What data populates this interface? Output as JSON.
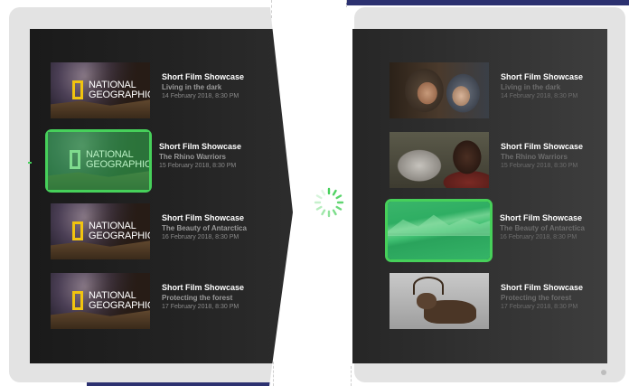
{
  "left_list": {
    "items": [
      {
        "title": "Short Film Showcase",
        "subtitle": "Living in the dark",
        "date": "14 February 2018, 8:30 PM",
        "logo_line1": "NATIONAL",
        "logo_line2": "GEOGRAPHIC"
      },
      {
        "title": "Short Film Showcase",
        "subtitle": "The Rhino Warriors",
        "date": "15 February 2018, 8:30 PM",
        "logo_line1": "NATIONAL",
        "logo_line2": "GEOGRAPHIC",
        "selected": true
      },
      {
        "title": "Short Film Showcase",
        "subtitle": "The Beauty of Antarctica",
        "date": "16 February 2018, 8:30 PM",
        "logo_line1": "NATIONAL",
        "logo_line2": "GEOGRAPHIC"
      },
      {
        "title": "Short Film Showcase",
        "subtitle": "Protecting the forest",
        "date": "17 February 2018, 8:30 PM",
        "logo_line1": "NATIONAL",
        "logo_line2": "GEOGRAPHIC"
      }
    ]
  },
  "right_list": {
    "items": [
      {
        "title": "Short Film Showcase",
        "subtitle": "Living in the dark",
        "date": "14 February 2018, 8:30 PM",
        "photo": "children-photo"
      },
      {
        "title": "Short Film Showcase",
        "subtitle": "The Rhino Warriors",
        "date": "15 February 2018, 8:30 PM",
        "photo": "rhino-photo"
      },
      {
        "title": "Short Film Showcase",
        "subtitle": "The Beauty of Antarctica",
        "date": "16 February 2018, 8:30 PM",
        "photo": "antarctica-photo",
        "selected": true
      },
      {
        "title": "Short Film Showcase",
        "subtitle": "Protecting the forest",
        "date": "17 February 2018, 8:30 PM",
        "photo": "reindeer-photo"
      }
    ]
  },
  "colors": {
    "accent_green": "#46d05a",
    "navy": "#2c3170",
    "logo_yellow": "#f1c40f"
  },
  "icons": {
    "loading": "spinner-icon"
  }
}
